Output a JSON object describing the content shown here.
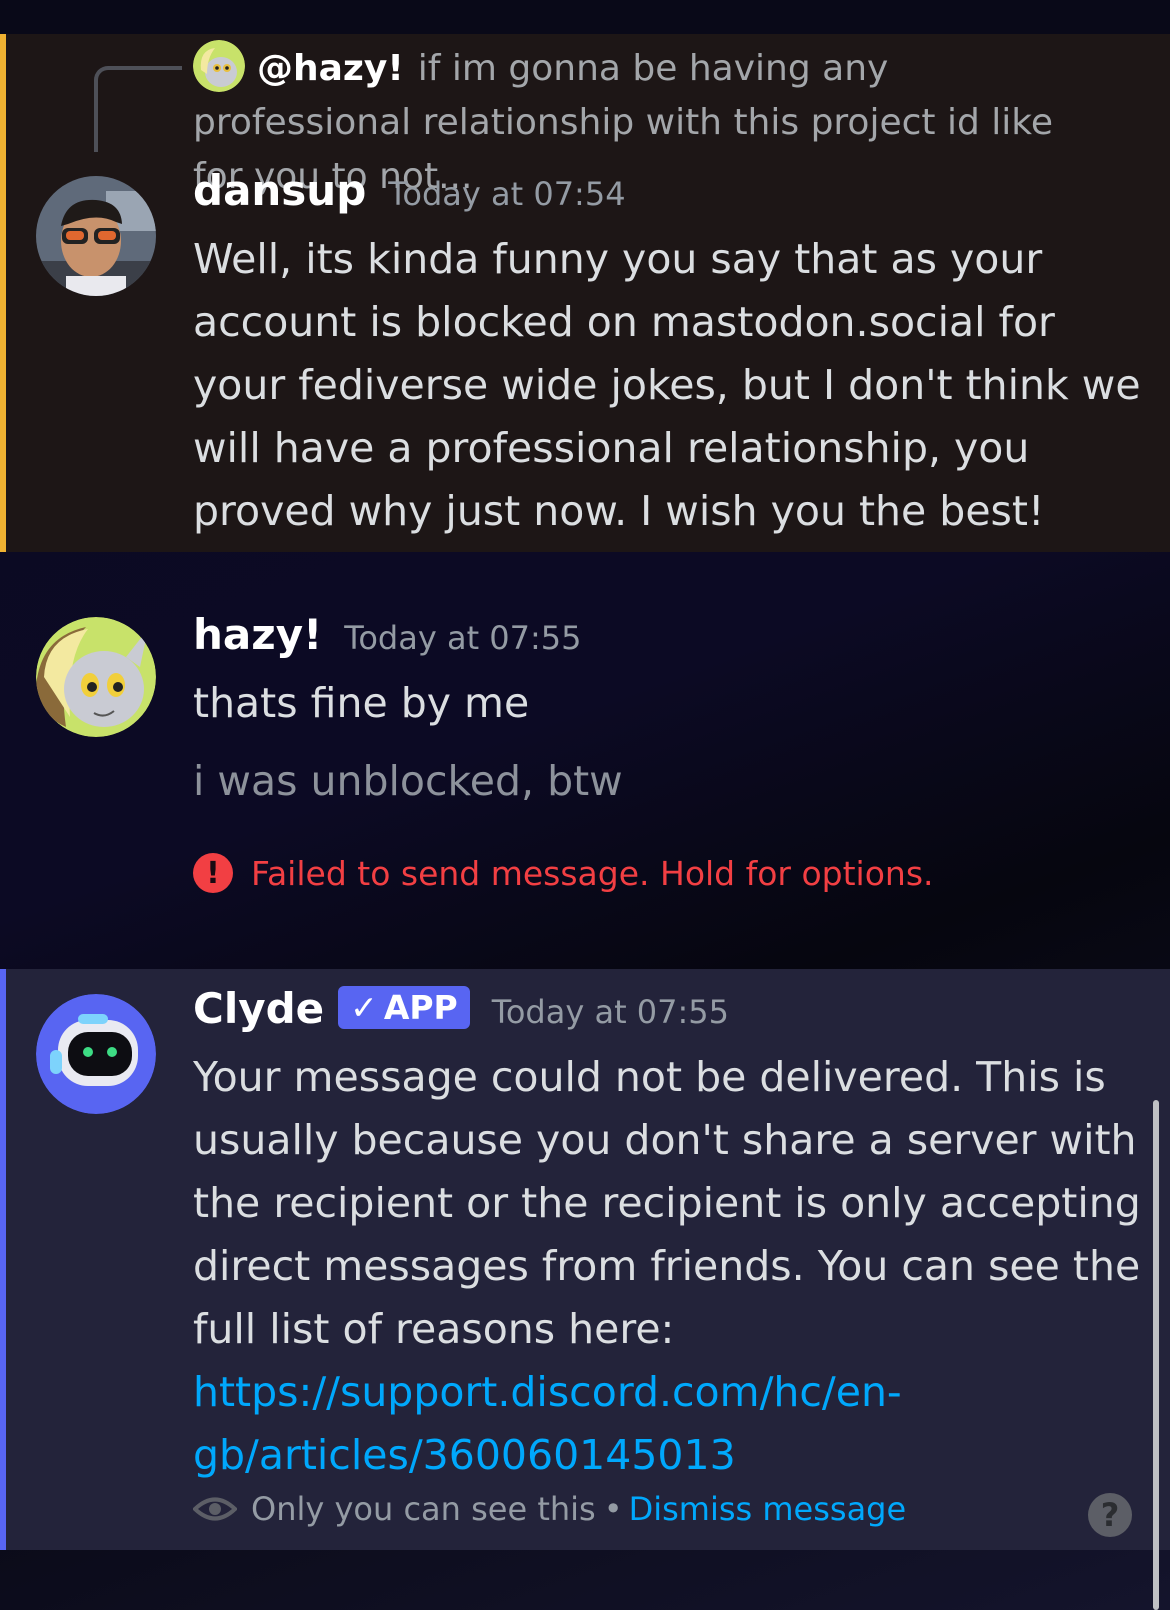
{
  "reply": {
    "mention": "@hazy!",
    "preview": "if im gonna be having any professional relationship with this project id like for you to not..."
  },
  "messages": [
    {
      "author": "dansup",
      "timestamp": "Today at 07:54",
      "text": "Well, its kinda funny you say that as your account is blocked on mastodon.social for your fediverse wide jokes, but I don't think we will have a professional relationship, you proved why just now. I wish you the best!"
    },
    {
      "author": "hazy!",
      "timestamp": "Today at 07:55",
      "text": "thats fine by me",
      "pending_text": "i was unblocked, btw",
      "error": "Failed to send message. Hold for options.",
      "error_icon": "!"
    },
    {
      "author": "Clyde",
      "badge": "APP",
      "badge_check": "✓",
      "timestamp": "Today at 07:55",
      "text": "Your message could not be delivered. This is usually because you don't share a server with the recipient or the recipient is only accepting direct messages from friends. You can see the full list of reasons here:",
      "link": "https://support.discord.com/hc/en-gb/articles/360060145013",
      "footer_visibility": "Only you can see this",
      "footer_separator": "•",
      "footer_dismiss": "Dismiss message",
      "help_icon": "?"
    }
  ],
  "colors": {
    "highlight_bar": "#f0b232",
    "error": "#f23f43",
    "app_badge": "#5865f2",
    "link": "#00a8fc"
  },
  "icons": {
    "error": "exclamation-circle-icon",
    "eye": "eye-icon",
    "help": "question-icon",
    "check": "check-icon"
  }
}
